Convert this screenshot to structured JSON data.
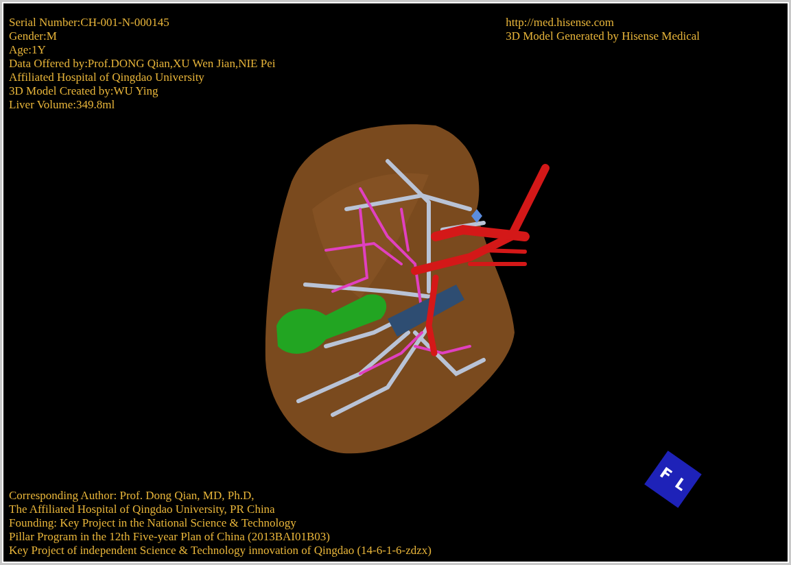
{
  "info_top_left": [
    "Serial Number:CH-001-N-000145",
    "Gender:M",
    "Age:1Y",
    "Data Offered by:Prof.DONG Qian,XU Wen Jian,NIE Pei",
    "Affiliated Hospital of Qingdao University",
    "3D Model Created by:WU Ying",
    "Liver Volume:349.8ml"
  ],
  "info_top_right": [
    "http://med.hisense.com",
    "3D Model Generated by Hisense Medical"
  ],
  "info_bottom_left": [
    "Corresponding Author: Prof. Dong Qian, MD, Ph.D,",
    "The Affiliated Hospital of Qingdao University, PR China",
    "Founding: Key Project in the National Science & Technology",
    "Pillar Program in the 12th Five-year Plan of China (2013BAI01B03)",
    "Key Project of independent Science & Technology innovation of Qingdao (14-6-1-6-zdzx)"
  ],
  "orientation_cube": {
    "faces": [
      "F",
      "L"
    ]
  }
}
